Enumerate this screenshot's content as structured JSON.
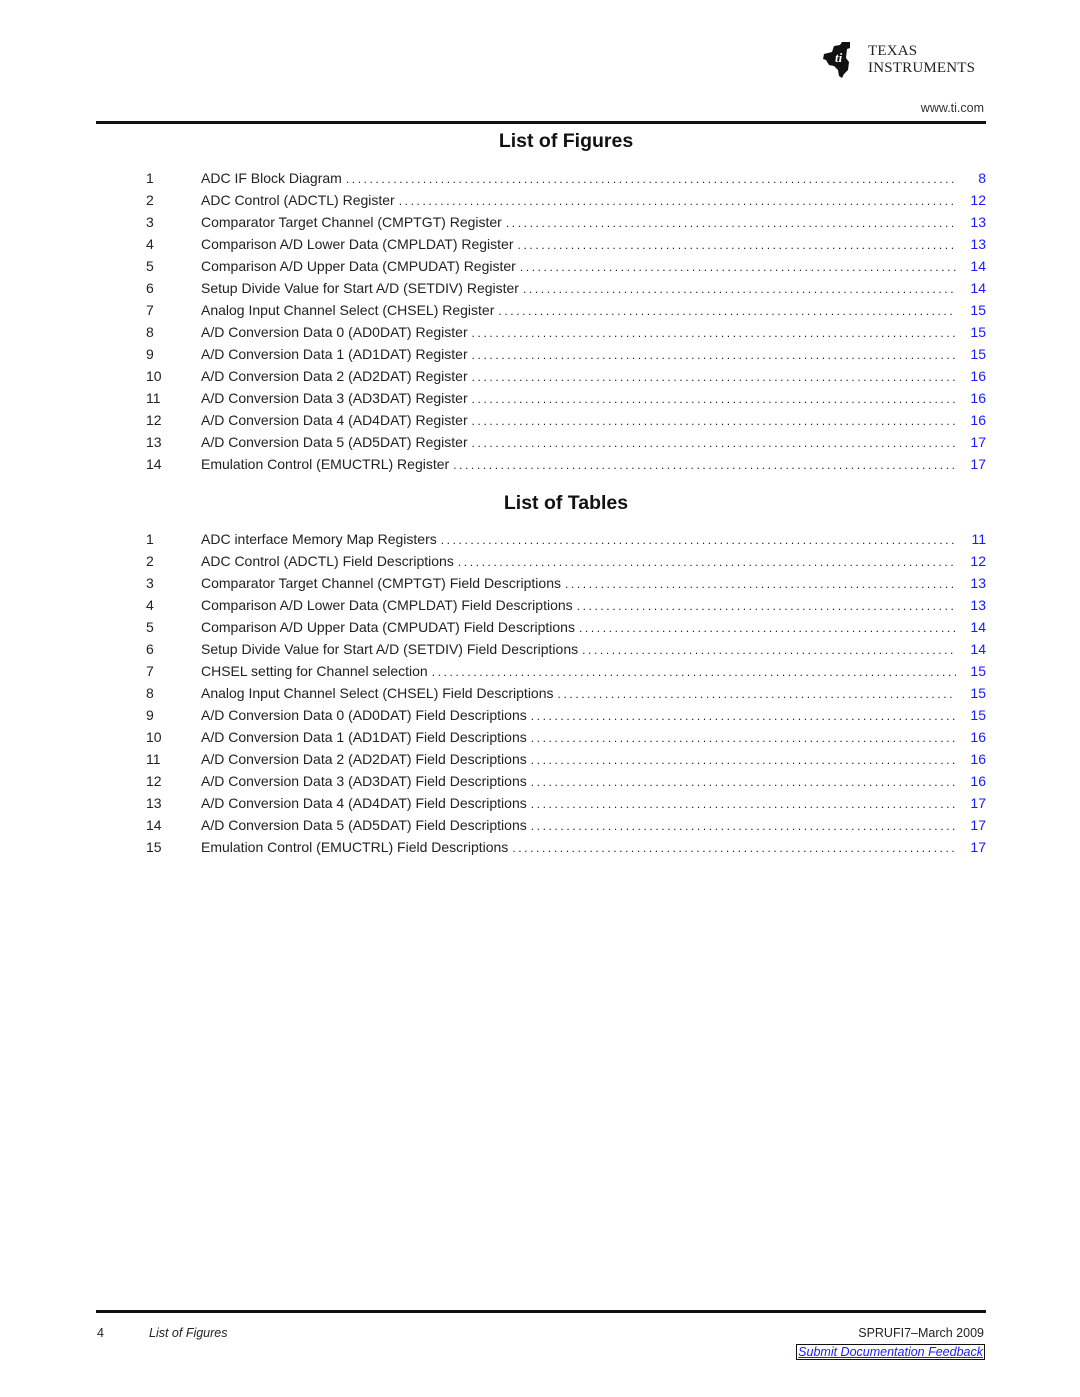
{
  "header": {
    "logo": {
      "line1": "Texas",
      "line2": "Instruments"
    },
    "url": "www.ti.com"
  },
  "colors": {
    "link": "#1a1aff",
    "text": "#222222"
  },
  "figures": {
    "title": "List of Figures",
    "items": [
      {
        "num": "1",
        "title": "ADC IF Block Diagram",
        "page": "8"
      },
      {
        "num": "2",
        "title": "ADC Control (ADCTL) Register",
        "page": "12"
      },
      {
        "num": "3",
        "title": "Comparator Target Channel (CMPTGT) Register",
        "page": "13"
      },
      {
        "num": "4",
        "title": "Comparison A/D Lower Data (CMPLDAT) Register",
        "page": "13"
      },
      {
        "num": "5",
        "title": "Comparison A/D Upper Data (CMPUDAT) Register",
        "page": "14"
      },
      {
        "num": "6",
        "title": "Setup Divide Value for Start A/D (SETDIV) Register",
        "page": "14"
      },
      {
        "num": "7",
        "title": "Analog Input Channel Select (CHSEL) Register",
        "page": "15"
      },
      {
        "num": "8",
        "title": "A/D Conversion Data 0 (AD0DAT) Register",
        "page": "15"
      },
      {
        "num": "9",
        "title": "A/D Conversion Data 1 (AD1DAT) Register",
        "page": "15"
      },
      {
        "num": "10",
        "title": "A/D Conversion Data 2 (AD2DAT) Register",
        "page": "16"
      },
      {
        "num": "11",
        "title": "A/D Conversion Data 3 (AD3DAT) Register",
        "page": "16"
      },
      {
        "num": "12",
        "title": "A/D Conversion Data 4 (AD4DAT) Register",
        "page": "16"
      },
      {
        "num": "13",
        "title": "A/D Conversion Data 5 (AD5DAT) Register",
        "page": "17"
      },
      {
        "num": "14",
        "title": "Emulation Control (EMUCTRL) Register",
        "page": "17"
      }
    ]
  },
  "tables": {
    "title": "List of Tables",
    "items": [
      {
        "num": "1",
        "title": "ADC interface Memory Map Registers",
        "page": "11"
      },
      {
        "num": "2",
        "title": "ADC Control (ADCTL) Field Descriptions",
        "page": "12"
      },
      {
        "num": "3",
        "title": "Comparator Target Channel (CMPTGT) Field Descriptions",
        "page": "13"
      },
      {
        "num": "4",
        "title": "Comparison A/D Lower Data (CMPLDAT) Field Descriptions",
        "page": "13"
      },
      {
        "num": "5",
        "title": "Comparison A/D Upper Data (CMPUDAT) Field Descriptions",
        "page": "14"
      },
      {
        "num": "6",
        "title": "Setup Divide Value for Start A/D (SETDIV) Field Descriptions",
        "page": "14"
      },
      {
        "num": "7",
        "title": "CHSEL setting for Channel selection",
        "page": "15"
      },
      {
        "num": "8",
        "title": "Analog Input Channel Select (CHSEL) Field Descriptions",
        "page": "15"
      },
      {
        "num": "9",
        "title": "A/D Conversion Data 0 (AD0DAT) Field Descriptions",
        "page": "15"
      },
      {
        "num": "10",
        "title": "A/D Conversion Data 1 (AD1DAT) Field Descriptions",
        "page": "16"
      },
      {
        "num": "11",
        "title": "A/D Conversion Data 2 (AD2DAT) Field Descriptions",
        "page": "16"
      },
      {
        "num": "12",
        "title": "A/D Conversion Data 3 (AD3DAT) Field Descriptions",
        "page": "16"
      },
      {
        "num": "13",
        "title": "A/D Conversion Data 4 (AD4DAT) Field Descriptions",
        "page": "17"
      },
      {
        "num": "14",
        "title": "A/D Conversion Data 5 (AD5DAT) Field Descriptions",
        "page": "17"
      },
      {
        "num": "15",
        "title": "Emulation Control (EMUCTRL) Field Descriptions",
        "page": "17"
      }
    ]
  },
  "footer": {
    "page_number": "4",
    "section": "List of Figures",
    "doc_id": "SPRUFI7–March 2009",
    "feedback_link": "Submit Documentation Feedback"
  }
}
